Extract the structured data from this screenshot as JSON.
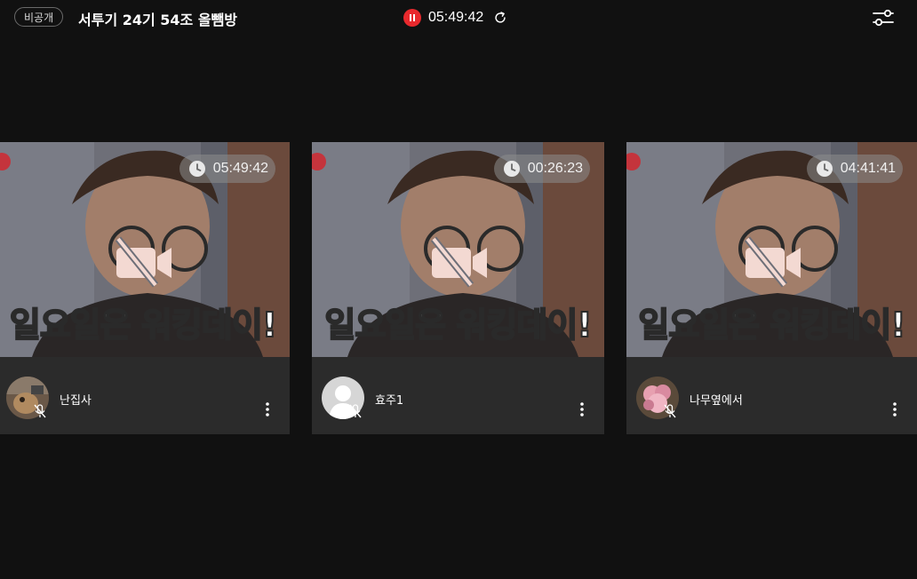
{
  "header": {
    "visibility_badge": "비공개",
    "room_title": "서투기 24기 54조 올뺌방",
    "elapsed_time": "05:49:42",
    "pause_icon": "pause-icon",
    "refresh_icon": "refresh-icon",
    "settings_icon": "sliders-icon",
    "recording_color": "#e8292d"
  },
  "participants": [
    {
      "name": "난집사",
      "timer": "05:49:42",
      "caption_highlight": "일요일",
      "caption_rest": "은 워킹데이!",
      "avatar": "cat-photo",
      "mic": "muted"
    },
    {
      "name": "효주1",
      "timer": "00:26:23",
      "caption_highlight": "일요일",
      "caption_rest": "은 워킹데이!",
      "avatar": "default-person",
      "mic": "muted"
    },
    {
      "name": "나무옆에서",
      "timer": "04:41:41",
      "caption_highlight": "일요일",
      "caption_rest": "은 워킹데이!",
      "avatar": "flower-photo",
      "mic": "muted"
    }
  ]
}
